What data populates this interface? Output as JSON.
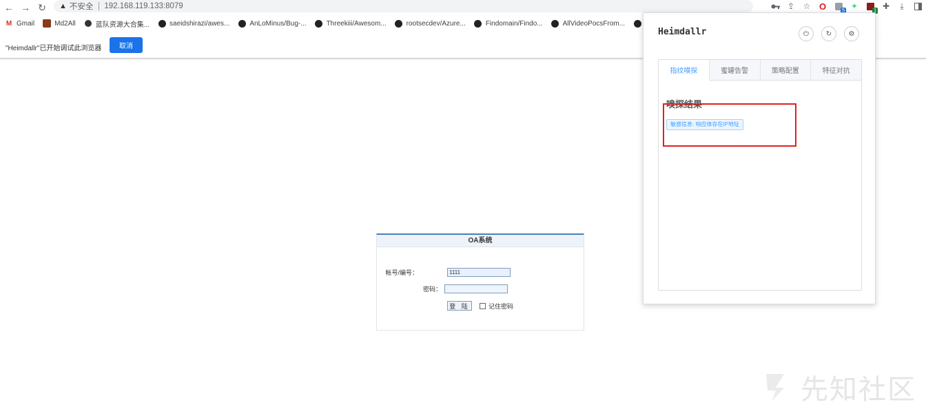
{
  "browser": {
    "insecure_label": "不安全",
    "url": "192.168.119.133:8079",
    "toolbar_icons": [
      "key-icon",
      "share-icon",
      "star-icon",
      "opera-icon",
      "extension-s-icon",
      "android-icon",
      "extension-red-icon",
      "puzzle-icon",
      "download-icon",
      "sidebar-icon"
    ],
    "badges": {
      "extension_s": "5",
      "extension_red": "1"
    }
  },
  "bookmarks": [
    {
      "label": "Gmail",
      "icon": "gmail-icon"
    },
    {
      "label": "Md2All",
      "icon": "md2all-icon"
    },
    {
      "label": "蓝队资源大合集...",
      "icon": "circle-icon"
    },
    {
      "label": "saeidshirazi/awes...",
      "icon": "github-icon"
    },
    {
      "label": "AnLoMinus/Bug-...",
      "icon": "github-icon"
    },
    {
      "label": "Threekiii/Awesom...",
      "icon": "github-icon"
    },
    {
      "label": "rootsecdev/Azure...",
      "icon": "github-icon"
    },
    {
      "label": "Findomain/Findo...",
      "icon": "github-icon"
    },
    {
      "label": "AllVideoPocsFrom...",
      "icon": "github-icon"
    }
  ],
  "infobar": {
    "message": "\"Heimdallr\"已开始调试此浏览器",
    "cancel_label": "取消"
  },
  "oa": {
    "title": "OA系统",
    "account_label": "帐号/编号：",
    "account_value": "1111",
    "password_label": "密码：",
    "login_label": "登 陆",
    "remember_label": "记住密码"
  },
  "popup": {
    "title": "Heimdallr",
    "tabs": [
      "指纹嗅探",
      "蜜罐告警",
      "策略配置",
      "特征对抗"
    ],
    "active_tab": 0,
    "result_title": "嗅探结果",
    "result_tag": "敏感信息: 响应体存在IP地址",
    "highlight_color": "#e02020",
    "accent_color": "#409eff"
  },
  "watermark": {
    "text": "先知社区"
  }
}
